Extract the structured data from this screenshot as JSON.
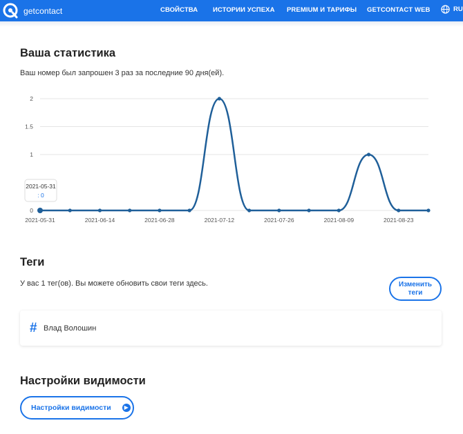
{
  "header": {
    "logo_text": "getcontact",
    "nav": [
      "СВОЙСТВА",
      "ИСТОРИИ УСПЕХА",
      "PREMIUM И ТАРИФЫ",
      "GETCONTACT WEB"
    ],
    "lang": "RU",
    "brand_color": "#1a73e8"
  },
  "stats": {
    "title": "Ваша статистика",
    "subtitle": "Ваш номер был запрошен 3 раз за последние 90 дня(ей)."
  },
  "chart_data": {
    "type": "line",
    "x": [
      "2021-05-31",
      "2021-06-07",
      "2021-06-14",
      "2021-06-21",
      "2021-06-28",
      "2021-07-05",
      "2021-07-12",
      "2021-07-19",
      "2021-07-26",
      "2021-08-02",
      "2021-08-09",
      "2021-08-16",
      "2021-08-23",
      "2021-08-30"
    ],
    "values": [
      0,
      0,
      0,
      0,
      0,
      0,
      2,
      0,
      0,
      0,
      0,
      1,
      0,
      0
    ],
    "x_tick_labels": [
      "2021-05-31",
      "2021-06-14",
      "2021-06-28",
      "2021-07-12",
      "2021-07-26",
      "2021-08-09",
      "2021-08-23"
    ],
    "y_tick_labels": [
      "0",
      "1",
      "1.5",
      "2"
    ],
    "y_ticks": [
      0,
      1,
      1.5,
      2
    ],
    "ylim": [
      0,
      2
    ],
    "grid": true,
    "color": "#1f5f99",
    "tooltip": {
      "date": "2021-05-31",
      "value": ": 0"
    }
  },
  "tags": {
    "title": "Теги",
    "subtitle": "У вас 1 тег(ов). Вы можете обновить свои теги здесь.",
    "change_button": "Изменить теги",
    "items": [
      {
        "icon": "hash-icon",
        "label": "Влад Волошин"
      }
    ]
  },
  "visibility": {
    "title": "Настройки видимости",
    "button": "Настройки видимости",
    "button_icon": "arrow-right-circle-icon"
  }
}
